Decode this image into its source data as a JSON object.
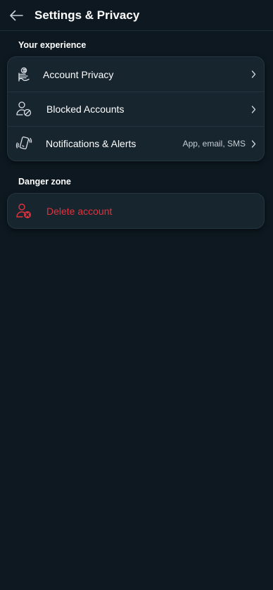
{
  "header": {
    "title": "Settings & Privacy"
  },
  "sections": [
    {
      "label": "Your experience",
      "items": [
        {
          "label": "Account Privacy",
          "icon": "privacy-list-icon",
          "value": ""
        },
        {
          "label": "Blocked Accounts",
          "icon": "user-blocked-icon",
          "value": ""
        },
        {
          "label": "Notifications & Alerts",
          "icon": "phone-vibrate-icon",
          "value": "App, email, SMS"
        }
      ]
    },
    {
      "label": "Danger zone",
      "items": [
        {
          "label": "Delete account",
          "icon": "user-remove-icon"
        }
      ]
    }
  ],
  "colors": {
    "background": "#0d1820",
    "card": "#17252f",
    "divider": "#243540",
    "text": "#ffffff",
    "muted": "#c6ced4",
    "danger": "#e0333c"
  }
}
